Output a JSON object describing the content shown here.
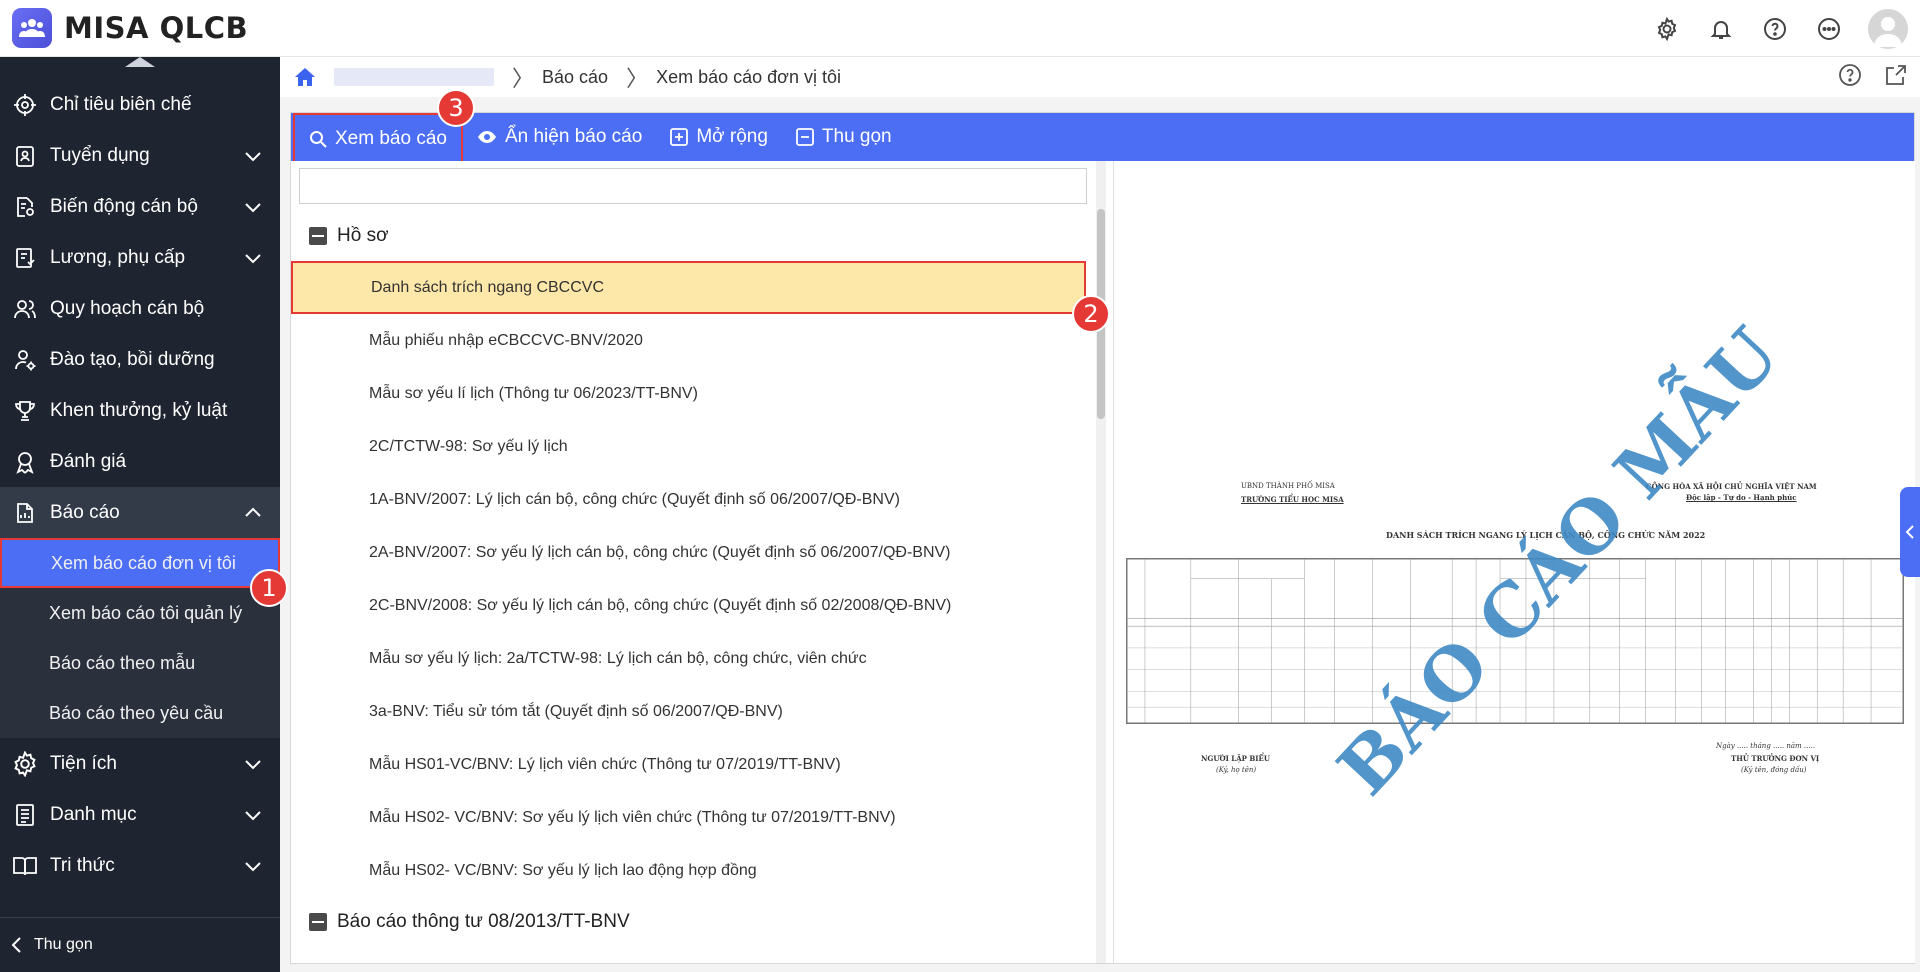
{
  "app": {
    "title": "MISA QLCB"
  },
  "sidebar": {
    "items": [
      {
        "label": "Chỉ tiêu biên chế",
        "icon": "target-icon",
        "has_children": false
      },
      {
        "label": "Tuyển dụng",
        "icon": "clipboard-icon",
        "has_children": true
      },
      {
        "label": "Biến động cán bộ",
        "icon": "doc-settings-icon",
        "has_children": true
      },
      {
        "label": "Lương, phụ cấp",
        "icon": "payroll-icon",
        "has_children": true
      },
      {
        "label": "Quy hoạch cán bộ",
        "icon": "users-icon",
        "has_children": false
      },
      {
        "label": "Đào tạo, bồi dưỡng",
        "icon": "user-gear-icon",
        "has_children": false
      },
      {
        "label": "Khen thưởng, kỷ luật",
        "icon": "trophy-icon",
        "has_children": false
      },
      {
        "label": "Đánh giá",
        "icon": "medal-icon",
        "has_children": false
      },
      {
        "label": "Báo cáo",
        "icon": "report-icon",
        "has_children": true,
        "expanded": true
      }
    ],
    "report_sub": [
      {
        "label": "Xem báo cáo đơn vị tôi",
        "active": true
      },
      {
        "label": "Xem báo cáo tôi quản lý"
      },
      {
        "label": "Báo cáo theo mẫu"
      },
      {
        "label": "Báo cáo theo yêu cầu"
      }
    ],
    "after_items": [
      {
        "label": "Tiện ích",
        "icon": "gear-icon"
      },
      {
        "label": "Danh mục",
        "icon": "list-icon"
      },
      {
        "label": "Tri thức",
        "icon": "book-icon"
      }
    ],
    "collapse_label": "Thu gọn"
  },
  "breadcrumb": {
    "items": [
      "Báo cáo",
      "Xem báo cáo đơn vị tôi"
    ]
  },
  "toolbar": {
    "view_label": "Xem báo cáo",
    "toggle_label": "Ẩn hiện báo cáo",
    "expand_label": "Mở rộng",
    "collapse_label": "Thu gọn"
  },
  "search": {
    "placeholder": ""
  },
  "tree": {
    "group1": "Hồ sơ",
    "items": [
      "Danh sách trích ngang CBCCVC",
      "Mẫu phiếu nhập eCBCCVC-BNV/2020",
      "Mẫu sơ yếu lí lịch (Thông tư 06/2023/TT-BNV)",
      "2C/TCTW-98: Sơ yếu lý lịch",
      "1A-BNV/2007: Lý lịch cán bộ, công chức (Quyết định số 06/2007/QĐ-BNV)",
      "2A-BNV/2007: Sơ yếu lý lịch cán bộ, công chức (Quyết định số 06/2007/QĐ-BNV)",
      "2C-BNV/2008: Sơ yếu lý lịch cán bộ, công chức (Quyết định số 02/2008/QĐ-BNV)",
      "Mẫu sơ yếu lý lịch: 2a/TCTW-98: Lý lịch cán bộ, công chức, viên chức",
      "3a-BNV: Tiểu sử tóm tắt (Quyết định số 06/2007/QĐ-BNV)",
      "Mẫu HS01-VC/BNV: Lý lịch viên chức (Thông tư 07/2019/TT-BNV)",
      "Mẫu HS02- VC/BNV: Sơ yếu lý lịch viên chức (Thông tư 07/2019/TT-BNV)",
      "Mẫu HS02- VC/BNV: Sơ yếu lý lịch lao động hợp đồng"
    ],
    "group2": "Báo cáo thông tư 08/2013/TT-BNV"
  },
  "preview": {
    "org_line1": "UBND THÀNH PHỐ MISA",
    "org_line2": "TRƯỜNG TIỂU HỌC MISA",
    "nation_line1": "CỘNG HÒA XÃ HỘI CHỦ NGHĨA VIỆT NAM",
    "nation_line2": "Độc lập - Tự do - Hạnh phúc",
    "doc_title": "DANH SÁCH TRÍCH NGANG LÝ LỊCH CÁN BỘ, CÔNG CHỨC NĂM 2022",
    "signer_left": "NGƯỜI LẬP BIỂU",
    "signer_left_note": "(Ký, họ tên)",
    "date_line": "Ngày ..... tháng ..... năm .....",
    "signer_right": "THỦ TRƯỞNG ĐƠN VỊ",
    "signer_right_note": "(Ký tên, đóng dấu)",
    "watermark": "BÁO CÁO MẪU"
  },
  "annotations": {
    "step1": "1",
    "step2": "2",
    "step3": "3"
  },
  "colors": {
    "sidebar_bg": "#1f2530",
    "accent": "#4c6ef5",
    "highlight": "#fde7a9",
    "annotation": "#e53935"
  }
}
